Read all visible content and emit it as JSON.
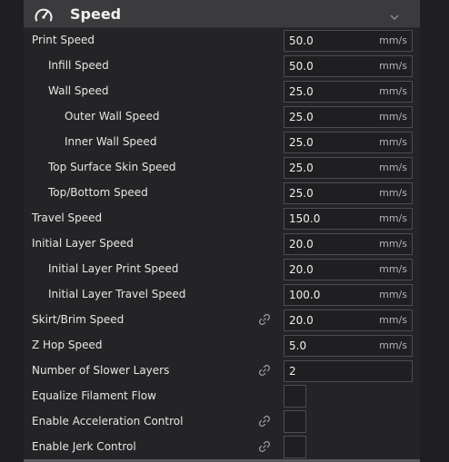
{
  "header": {
    "title": "Speed",
    "icon": "speedometer-icon",
    "collapse_icon": "chevron-down-icon"
  },
  "settings": [
    {
      "key": "print_speed",
      "label": "Print Speed",
      "indent": 0,
      "type": "number",
      "value": "50.0",
      "unit": "mm/s",
      "linked": false
    },
    {
      "key": "infill_speed",
      "label": "Infill Speed",
      "indent": 1,
      "type": "number",
      "value": "50.0",
      "unit": "mm/s",
      "linked": false
    },
    {
      "key": "wall_speed",
      "label": "Wall Speed",
      "indent": 1,
      "type": "number",
      "value": "25.0",
      "unit": "mm/s",
      "linked": false
    },
    {
      "key": "outer_wall_speed",
      "label": "Outer Wall Speed",
      "indent": 2,
      "type": "number",
      "value": "25.0",
      "unit": "mm/s",
      "linked": false
    },
    {
      "key": "inner_wall_speed",
      "label": "Inner Wall Speed",
      "indent": 2,
      "type": "number",
      "value": "25.0",
      "unit": "mm/s",
      "linked": false
    },
    {
      "key": "top_surface_skin_speed",
      "label": "Top Surface Skin Speed",
      "indent": 1,
      "type": "number",
      "value": "25.0",
      "unit": "mm/s",
      "linked": false
    },
    {
      "key": "top_bottom_speed",
      "label": "Top/Bottom Speed",
      "indent": 1,
      "type": "number",
      "value": "25.0",
      "unit": "mm/s",
      "linked": false
    },
    {
      "key": "travel_speed",
      "label": "Travel Speed",
      "indent": 0,
      "type": "number",
      "value": "150.0",
      "unit": "mm/s",
      "linked": false
    },
    {
      "key": "initial_layer_speed",
      "label": "Initial Layer Speed",
      "indent": 0,
      "type": "number",
      "value": "20.0",
      "unit": "mm/s",
      "linked": false
    },
    {
      "key": "initial_layer_print_speed",
      "label": "Initial Layer Print Speed",
      "indent": 1,
      "type": "number",
      "value": "20.0",
      "unit": "mm/s",
      "linked": false
    },
    {
      "key": "initial_layer_travel_speed",
      "label": "Initial Layer Travel Speed",
      "indent": 1,
      "type": "number",
      "value": "100.0",
      "unit": "mm/s",
      "linked": false
    },
    {
      "key": "skirt_brim_speed",
      "label": "Skirt/Brim Speed",
      "indent": 0,
      "type": "number",
      "value": "20.0",
      "unit": "mm/s",
      "linked": true
    },
    {
      "key": "z_hop_speed",
      "label": "Z Hop Speed",
      "indent": 0,
      "type": "number",
      "value": "5.0",
      "unit": "mm/s",
      "linked": false
    },
    {
      "key": "number_of_slower_layers",
      "label": "Number of Slower Layers",
      "indent": 0,
      "type": "number",
      "value": "2",
      "unit": "",
      "linked": true
    },
    {
      "key": "equalize_filament_flow",
      "label": "Equalize Filament Flow",
      "indent": 0,
      "type": "checkbox",
      "checked": false,
      "linked": false
    },
    {
      "key": "enable_acceleration_control",
      "label": "Enable Acceleration Control",
      "indent": 0,
      "type": "checkbox",
      "checked": false,
      "linked": true
    },
    {
      "key": "enable_jerk_control",
      "label": "Enable Jerk Control",
      "indent": 0,
      "type": "checkbox",
      "checked": false,
      "linked": true
    }
  ],
  "link_icon": "link-icon",
  "colors": {
    "panel_bg": "#242426",
    "header_bg": "#3b3b3d",
    "field_border": "#4d4d51",
    "text": "#e6e6e6",
    "unit_text": "#b4b4b8"
  }
}
